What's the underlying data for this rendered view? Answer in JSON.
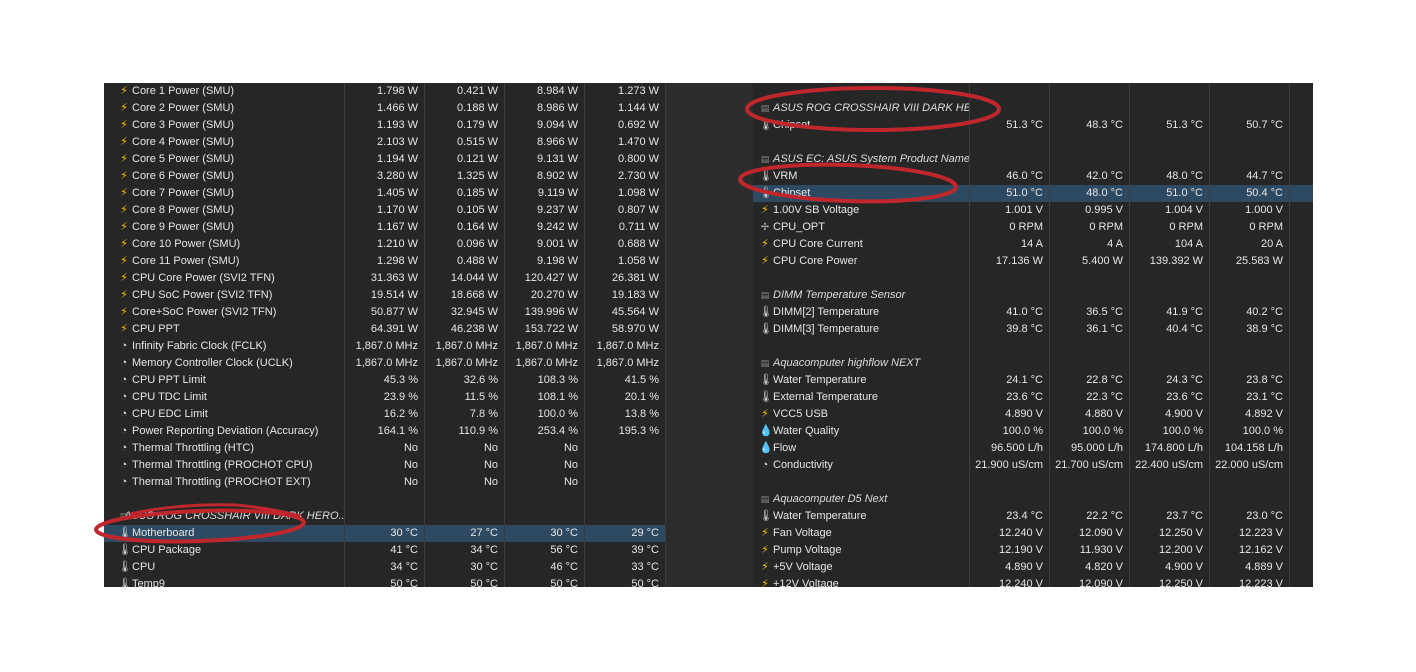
{
  "left": {
    "rows": [
      {
        "type": "sensor",
        "icon": "bolt-icon",
        "name": "Core 1 Power (SMU)",
        "v": [
          "1.798 W",
          "0.421 W",
          "8.984 W",
          "1.273 W"
        ]
      },
      {
        "type": "sensor",
        "icon": "bolt-icon",
        "name": "Core 2 Power (SMU)",
        "v": [
          "1.466 W",
          "0.188 W",
          "8.986 W",
          "1.144 W"
        ]
      },
      {
        "type": "sensor",
        "icon": "bolt-icon",
        "name": "Core 3 Power (SMU)",
        "v": [
          "1.193 W",
          "0.179 W",
          "9.094 W",
          "0.692 W"
        ]
      },
      {
        "type": "sensor",
        "icon": "bolt-icon",
        "name": "Core 4 Power (SMU)",
        "v": [
          "2.103 W",
          "0.515 W",
          "8.966 W",
          "1.470 W"
        ]
      },
      {
        "type": "sensor",
        "icon": "bolt-icon",
        "name": "Core 5 Power (SMU)",
        "v": [
          "1.194 W",
          "0.121 W",
          "9.131 W",
          "0.800 W"
        ]
      },
      {
        "type": "sensor",
        "icon": "bolt-icon",
        "name": "Core 6 Power (SMU)",
        "v": [
          "3.280 W",
          "1.325 W",
          "8.902 W",
          "2.730 W"
        ]
      },
      {
        "type": "sensor",
        "icon": "bolt-icon",
        "name": "Core 7 Power (SMU)",
        "v": [
          "1.405 W",
          "0.185 W",
          "9.119 W",
          "1.098 W"
        ]
      },
      {
        "type": "sensor",
        "icon": "bolt-icon",
        "name": "Core 8 Power (SMU)",
        "v": [
          "1.170 W",
          "0.105 W",
          "9.237 W",
          "0.807 W"
        ]
      },
      {
        "type": "sensor",
        "icon": "bolt-icon",
        "name": "Core 9 Power (SMU)",
        "v": [
          "1.167 W",
          "0.164 W",
          "9.242 W",
          "0.711 W"
        ]
      },
      {
        "type": "sensor",
        "icon": "bolt-icon",
        "name": "Core 10 Power (SMU)",
        "v": [
          "1.210 W",
          "0.096 W",
          "9.001 W",
          "0.688 W"
        ]
      },
      {
        "type": "sensor",
        "icon": "bolt-icon",
        "name": "Core 11 Power (SMU)",
        "v": [
          "1.298 W",
          "0.488 W",
          "9.198 W",
          "1.058 W"
        ]
      },
      {
        "type": "sensor",
        "icon": "bolt-icon",
        "name": "CPU Core Power (SVI2 TFN)",
        "v": [
          "31.363 W",
          "14.044 W",
          "120.427 W",
          "26.381 W"
        ]
      },
      {
        "type": "sensor",
        "icon": "bolt-icon",
        "name": "CPU SoC Power (SVI2 TFN)",
        "v": [
          "19.514 W",
          "18.668 W",
          "20.270 W",
          "19.183 W"
        ]
      },
      {
        "type": "sensor",
        "icon": "bolt-icon",
        "name": "Core+SoC Power (SVI2 TFN)",
        "v": [
          "50.877 W",
          "32.945 W",
          "139.996 W",
          "45.564 W"
        ]
      },
      {
        "type": "sensor",
        "icon": "bolt-icon",
        "name": "CPU PPT",
        "v": [
          "64.391 W",
          "46.238 W",
          "153.722 W",
          "58.970 W"
        ]
      },
      {
        "type": "sensor",
        "icon": "clock-icon",
        "name": "Infinity Fabric Clock (FCLK)",
        "v": [
          "1,867.0 MHz",
          "1,867.0 MHz",
          "1,867.0 MHz",
          "1,867.0 MHz"
        ]
      },
      {
        "type": "sensor",
        "icon": "clock-icon",
        "name": "Memory Controller Clock (UCLK)",
        "v": [
          "1,867.0 MHz",
          "1,867.0 MHz",
          "1,867.0 MHz",
          "1,867.0 MHz"
        ]
      },
      {
        "type": "sensor",
        "icon": "clock-icon",
        "name": "CPU PPT Limit",
        "v": [
          "45.3 %",
          "32.6 %",
          "108.3 %",
          "41.5 %"
        ]
      },
      {
        "type": "sensor",
        "icon": "clock-icon",
        "name": "CPU TDC Limit",
        "v": [
          "23.9 %",
          "11.5 %",
          "108.1 %",
          "20.1 %"
        ]
      },
      {
        "type": "sensor",
        "icon": "clock-icon",
        "name": "CPU EDC Limit",
        "v": [
          "16.2 %",
          "7.8 %",
          "100.0 %",
          "13.8 %"
        ]
      },
      {
        "type": "sensor",
        "icon": "clock-icon",
        "name": "Power Reporting Deviation (Accuracy)",
        "v": [
          "164.1 %",
          "110.9 %",
          "253.4 %",
          "195.3 %"
        ]
      },
      {
        "type": "sensor",
        "icon": "clock-icon",
        "name": "Thermal Throttling (HTC)",
        "v": [
          "No",
          "No",
          "No",
          ""
        ]
      },
      {
        "type": "sensor",
        "icon": "clock-icon",
        "name": "Thermal Throttling (PROCHOT CPU)",
        "v": [
          "No",
          "No",
          "No",
          ""
        ]
      },
      {
        "type": "sensor",
        "icon": "clock-icon",
        "name": "Thermal Throttling (PROCHOT EXT)",
        "v": [
          "No",
          "No",
          "No",
          ""
        ]
      },
      {
        "type": "blank"
      },
      {
        "type": "group",
        "name": "ASUS ROG CROSSHAIR VIII DARK HERO..."
      },
      {
        "type": "sensor",
        "icon": "thermometer-icon",
        "name": "Motherboard",
        "v": [
          "30 °C",
          "27 °C",
          "30 °C",
          "29 °C"
        ],
        "sel": true
      },
      {
        "type": "sensor",
        "icon": "thermometer-icon",
        "name": "CPU Package",
        "v": [
          "41 °C",
          "34 °C",
          "56 °C",
          "39 °C"
        ]
      },
      {
        "type": "sensor",
        "icon": "thermometer-icon",
        "name": "CPU",
        "v": [
          "34 °C",
          "30 °C",
          "46 °C",
          "33 °C"
        ]
      },
      {
        "type": "sensor",
        "icon": "thermometer-icon",
        "name": "Temp9",
        "v": [
          "50 °C",
          "50 °C",
          "50 °C",
          "50 °C"
        ]
      }
    ]
  },
  "right": {
    "rows": [
      {
        "type": "blank"
      },
      {
        "type": "group",
        "name": "ASUS ROG CROSSHAIR VIII DARK HE..."
      },
      {
        "type": "sensor",
        "icon": "thermometer-icon",
        "name": "Chipset",
        "v": [
          "51.3 °C",
          "48.3 °C",
          "51.3 °C",
          "50.7 °C"
        ]
      },
      {
        "type": "blank"
      },
      {
        "type": "group",
        "name": "ASUS EC: ASUS System Product Name"
      },
      {
        "type": "sensor",
        "icon": "thermometer-icon",
        "name": "VRM",
        "v": [
          "46.0 °C",
          "42.0 °C",
          "48.0 °C",
          "44.7 °C"
        ]
      },
      {
        "type": "sensor",
        "icon": "thermometer-icon",
        "name": "Chipset",
        "v": [
          "51.0 °C",
          "48.0 °C",
          "51.0 °C",
          "50.4 °C"
        ],
        "sel": true
      },
      {
        "type": "sensor",
        "icon": "bolt-icon",
        "name": "1.00V SB Voltage",
        "v": [
          "1.001 V",
          "0.995 V",
          "1.004 V",
          "1.000 V"
        ]
      },
      {
        "type": "sensor",
        "icon": "fan-icon",
        "name": "CPU_OPT",
        "v": [
          "0 RPM",
          "0 RPM",
          "0 RPM",
          "0 RPM"
        ]
      },
      {
        "type": "sensor",
        "icon": "bolt-icon",
        "name": "CPU Core Current",
        "v": [
          "14 A",
          "4 A",
          "104 A",
          "20 A"
        ]
      },
      {
        "type": "sensor",
        "icon": "bolt-icon",
        "name": "CPU Core Power",
        "v": [
          "17.136 W",
          "5.400 W",
          "139.392 W",
          "25.583 W"
        ]
      },
      {
        "type": "blank"
      },
      {
        "type": "group",
        "name": "DIMM Temperature Sensor"
      },
      {
        "type": "sensor",
        "icon": "thermometer-icon",
        "name": "DIMM[2] Temperature",
        "v": [
          "41.0 °C",
          "36.5 °C",
          "41.9 °C",
          "40.2 °C"
        ]
      },
      {
        "type": "sensor",
        "icon": "thermometer-icon",
        "name": "DIMM[3] Temperature",
        "v": [
          "39.8 °C",
          "36.1 °C",
          "40.4 °C",
          "38.9 °C"
        ]
      },
      {
        "type": "blank"
      },
      {
        "type": "group",
        "name": "Aquacomputer highflow NEXT"
      },
      {
        "type": "sensor",
        "icon": "thermometer-icon",
        "name": "Water Temperature",
        "v": [
          "24.1 °C",
          "22.8 °C",
          "24.3 °C",
          "23.8 °C"
        ]
      },
      {
        "type": "sensor",
        "icon": "thermometer-icon",
        "name": "External Temperature",
        "v": [
          "23.6 °C",
          "22.3 °C",
          "23.6 °C",
          "23.1 °C"
        ]
      },
      {
        "type": "sensor",
        "icon": "bolt-icon",
        "name": "VCC5 USB",
        "v": [
          "4.890 V",
          "4.880 V",
          "4.900 V",
          "4.892 V"
        ]
      },
      {
        "type": "sensor",
        "icon": "drop-icon",
        "name": "Water Quality",
        "v": [
          "100.0 %",
          "100.0 %",
          "100.0 %",
          "100.0 %"
        ]
      },
      {
        "type": "sensor",
        "icon": "drop-icon",
        "name": "Flow",
        "v": [
          "96.500 L/h",
          "95.000 L/h",
          "174.800 L/h",
          "104.158 L/h"
        ]
      },
      {
        "type": "sensor",
        "icon": "clock-icon",
        "name": "Conductivity",
        "v": [
          "21.900 uS/cm",
          "21.700 uS/cm",
          "22.400 uS/cm",
          "22.000 uS/cm"
        ]
      },
      {
        "type": "blank"
      },
      {
        "type": "group",
        "name": "Aquacomputer D5 Next"
      },
      {
        "type": "sensor",
        "icon": "thermometer-icon",
        "name": "Water Temperature",
        "v": [
          "23.4 °C",
          "22.2 °C",
          "23.7 °C",
          "23.0 °C"
        ]
      },
      {
        "type": "sensor",
        "icon": "bolt-icon",
        "name": "Fan Voltage",
        "v": [
          "12.240 V",
          "12.090 V",
          "12.250 V",
          "12.223 V"
        ]
      },
      {
        "type": "sensor",
        "icon": "bolt-icon",
        "name": "Pump Voltage",
        "v": [
          "12.190 V",
          "11.930 V",
          "12.200 V",
          "12.162 V"
        ]
      },
      {
        "type": "sensor",
        "icon": "bolt-icon",
        "name": "+5V Voltage",
        "v": [
          "4.890 V",
          "4.820 V",
          "4.900 V",
          "4.889 V"
        ]
      },
      {
        "type": "sensor",
        "icon": "bolt-icon",
        "name": "+12V Voltage",
        "v": [
          "12.240 V",
          "12.090 V",
          "12.250 V",
          "12.223 V"
        ]
      }
    ]
  },
  "colors": {
    "background": "#262626",
    "selected_row": "#2e4a63",
    "annotation": "#c0272d",
    "bolt": "#f5c400"
  }
}
